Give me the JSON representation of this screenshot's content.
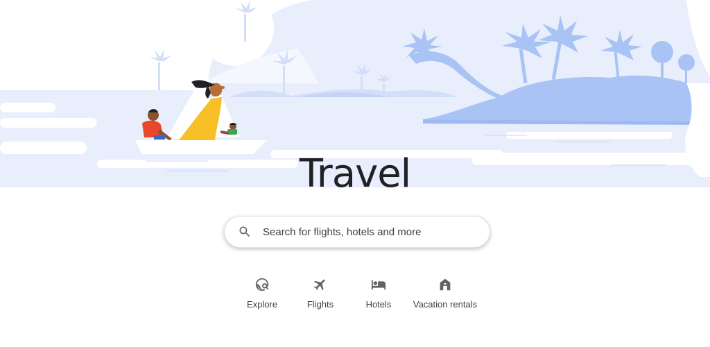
{
  "page": {
    "title": "Travel"
  },
  "search": {
    "placeholder": "Search for flights, hotels and more"
  },
  "nav": {
    "items": [
      {
        "label": "Explore",
        "icon": "explore-globe-icon"
      },
      {
        "label": "Flights",
        "icon": "airplane-icon"
      },
      {
        "label": "Hotels",
        "icon": "hotel-bed-icon"
      },
      {
        "label": "Vacation rentals",
        "icon": "house-icon"
      }
    ]
  },
  "colors": {
    "sky": "#e8eefb",
    "cloud": "#ffffff",
    "island": "#aac3f5",
    "palm_light": "#d3def8",
    "sail": "#ffffff",
    "dress": "#f6c026",
    "shirt": "#e8472a",
    "text": "#202124",
    "icon": "#5f6368"
  }
}
